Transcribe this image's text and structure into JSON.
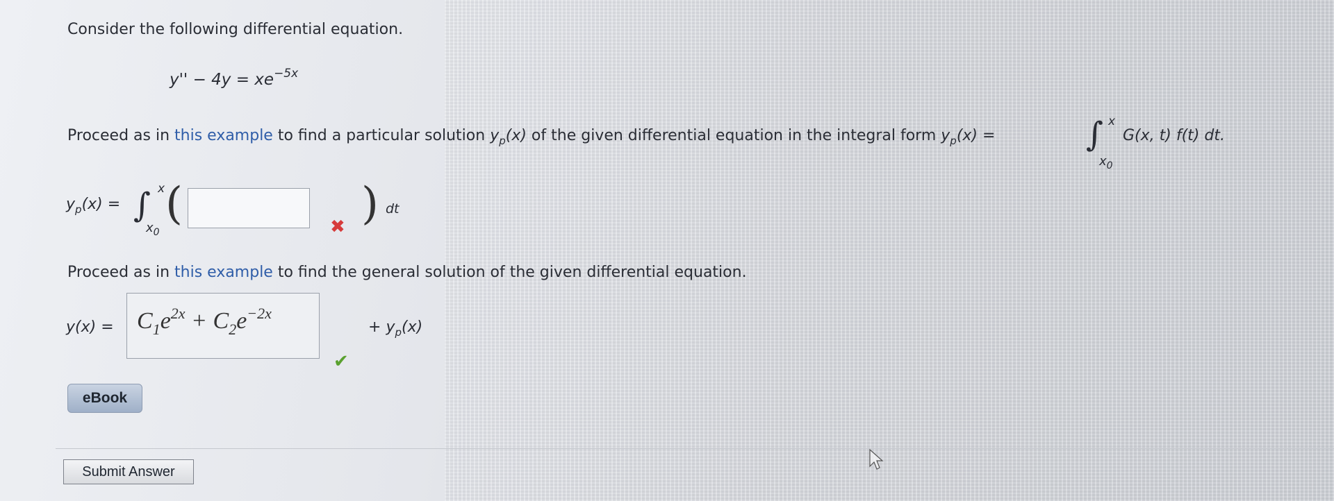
{
  "question": {
    "intro": "Consider the following differential equation.",
    "equation": {
      "lhs": "y'' − 4y = xe",
      "exponent": "−5x"
    },
    "instruction1": {
      "pre": "Proceed as in ",
      "link": "this example",
      "mid": " to find a particular solution ",
      "yp_base": "y",
      "yp_sub": "p",
      "yp_arg": "(x)",
      "post": " of the given differential equation in the integral form ",
      "form_lhs_base": "y",
      "form_lhs_sub": "p",
      "form_lhs_arg": "(x) = ",
      "integral": "∫",
      "upper": "x",
      "lower_base": "x",
      "lower_sub": "0",
      "integrand": "G(x, t) f(t) dt."
    },
    "answer1": {
      "lhs_base": "y",
      "lhs_sub": "p",
      "lhs_arg": "(x) = ",
      "integral": "∫",
      "upper": "x",
      "lower_base": "x",
      "lower_sub": "0",
      "open_paren": "(",
      "close_paren": ")",
      "blank_value": "",
      "status_icon": "✖",
      "status_color": "#d63b3b",
      "suffix": "dt"
    },
    "instruction2": {
      "pre": "Proceed as in ",
      "link": "this example",
      "post": " to find the general solution of the given differential equation."
    },
    "answer2": {
      "lhs": "y(x) = ",
      "c1": "C",
      "c1_sub": "1",
      "e1": "e",
      "e1_sup": "2x",
      "plus": " + ",
      "c2": "C",
      "c2_sub": "2",
      "e2": "e",
      "e2_sup": "−2x",
      "status_icon": "✔",
      "status_color": "#5aa12f",
      "tail_plus": "+ ",
      "tail_base": "y",
      "tail_sub": "p",
      "tail_arg": "(x)"
    }
  },
  "buttons": {
    "ebook": "eBook",
    "submit": "Submit Answer"
  }
}
